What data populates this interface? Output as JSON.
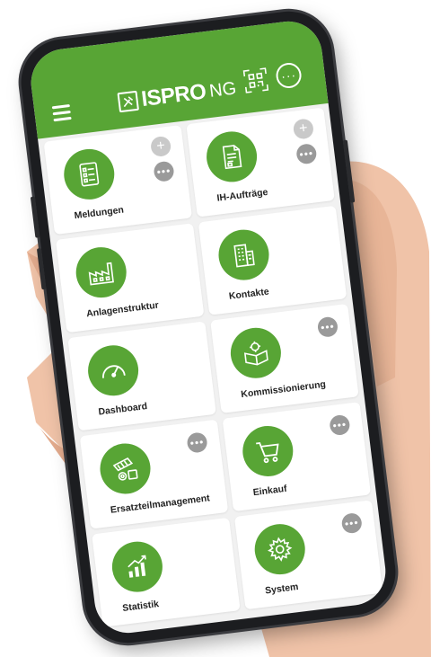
{
  "colors": {
    "brand_green": "#58a535",
    "tile_bg": "#ffffff",
    "screen_bg": "#f1f1f1"
  },
  "header": {
    "logo_text": "ISPRO",
    "logo_suffix": "NG",
    "menu_icon": "hamburger-menu-icon",
    "qr_icon": "qr-code-scan-icon",
    "more_icon": "more-options-icon"
  },
  "tiles": [
    {
      "label": "Meldungen",
      "icon": "checklist-icon",
      "add": true,
      "more": true
    },
    {
      "label": "IH-Aufträge",
      "icon": "work-order-document-icon",
      "add": true,
      "more": true
    },
    {
      "label": "Anlagenstruktur",
      "icon": "factory-icon",
      "add": false,
      "more": false
    },
    {
      "label": "Kontakte",
      "icon": "building-icon",
      "add": false,
      "more": false
    },
    {
      "label": "Dashboard",
      "icon": "gauge-icon",
      "add": false,
      "more": false
    },
    {
      "label": "Kommissionierung",
      "icon": "box-gear-icon",
      "add": false,
      "more": true
    },
    {
      "label": "Ersatzteilmanagement",
      "icon": "spare-parts-icon",
      "add": false,
      "more": true
    },
    {
      "label": "Einkauf",
      "icon": "shopping-cart-icon",
      "add": false,
      "more": true
    },
    {
      "label": "Statistik",
      "icon": "bar-chart-icon",
      "add": false,
      "more": false
    },
    {
      "label": "System",
      "icon": "settings-gear-icon",
      "add": false,
      "more": true
    }
  ],
  "glyphs": {
    "add": "+",
    "more": "•••",
    "more_header": "···"
  }
}
